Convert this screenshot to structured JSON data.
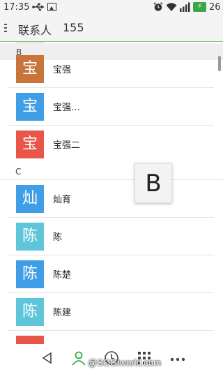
{
  "status_bar": {
    "time": "17:35",
    "battery": "26",
    "icons": [
      "usb-icon",
      "image-icon",
      "alarm-icon",
      "wifi-icon",
      "signal-icon",
      "battery-icon"
    ],
    "battery_color": "#3aa84a"
  },
  "header": {
    "title": "联系人",
    "count": "155",
    "menu_icon": "menu-icon"
  },
  "sections": [
    {
      "letter": "B",
      "contacts": [
        {
          "avatar": "宝",
          "name": "宝强",
          "color": "#c8743a"
        },
        {
          "avatar": "宝",
          "name": "宝强…",
          "color": "#3f9ee6"
        },
        {
          "avatar": "宝",
          "name": "宝强二",
          "color": "#e8564a"
        }
      ]
    },
    {
      "letter": "C",
      "contacts": [
        {
          "avatar": "灿",
          "name": "灿育",
          "color": "#3f9ee6"
        },
        {
          "avatar": "陈",
          "name": "陈",
          "color": "#5fc5d8"
        },
        {
          "avatar": "陈",
          "name": "陈楚",
          "color": "#3f9ee6"
        },
        {
          "avatar": "陈",
          "name": "陈建",
          "color": "#5fc5d8"
        }
      ]
    }
  ],
  "index_popup": "B",
  "bottom_nav": {
    "items": [
      "back-icon",
      "contacts-icon",
      "recent-calls-icon",
      "dialpad-icon",
      "more-icon"
    ],
    "active_color": "#3aa84a"
  },
  "watermark": "@SOGIworld.com"
}
